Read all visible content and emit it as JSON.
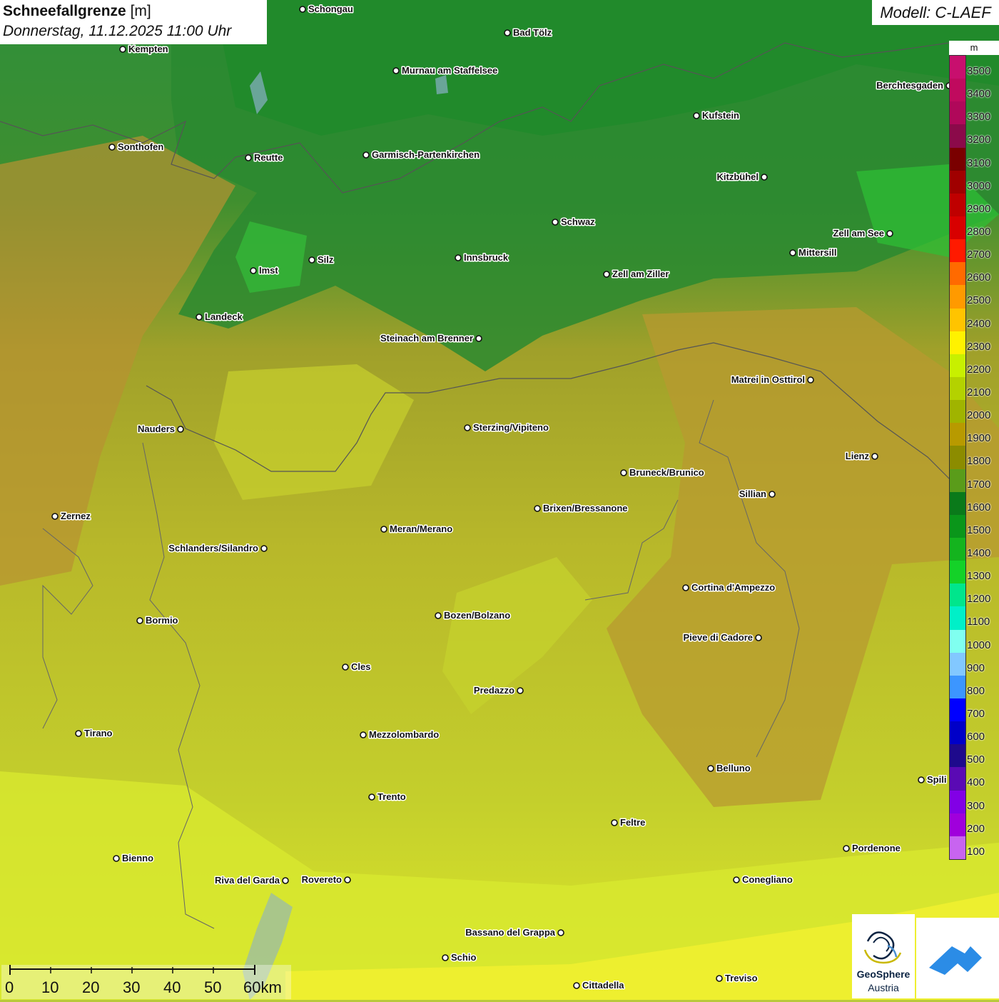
{
  "title": {
    "parameter": "Schneefallgrenze",
    "unit": "[m]",
    "datetime": "Donnerstag, 11.12.2025 11:00 Uhr"
  },
  "model": "Modell: C-LAEF",
  "legend": {
    "unit": "m",
    "levels": [
      "3500",
      "3400",
      "3300",
      "3200",
      "3100",
      "3000",
      "2900",
      "2800",
      "2700",
      "2600",
      "2500",
      "2400",
      "2300",
      "2200",
      "2100",
      "2000",
      "1900",
      "1800",
      "1700",
      "1600",
      "1500",
      "1400",
      "1300",
      "1200",
      "1100",
      "1000",
      "900",
      "800",
      "700",
      "600",
      "500",
      "400",
      "300",
      "200",
      "100"
    ],
    "colors": [
      "#c80f6e",
      "#c00a5e",
      "#b0085a",
      "#8b0a4a",
      "#7a0000",
      "#a00000",
      "#bf0000",
      "#d80000",
      "#ff1a00",
      "#ff6a00",
      "#ff9a00",
      "#ffc400",
      "#fff200",
      "#c8f000",
      "#b4d200",
      "#a0b400",
      "#b89a00",
      "#8c8c00",
      "#5a9c1a",
      "#0a7a1a",
      "#0a961a",
      "#14b41e",
      "#14d228",
      "#00e68c",
      "#00f0c8",
      "#80fff0",
      "#82c8ff",
      "#3c96ff",
      "#0000ff",
      "#0000c8",
      "#1e0a8c",
      "#5a0ab4",
      "#8200e6",
      "#a000dc",
      "#c864f0"
    ]
  },
  "cities": [
    {
      "name": "Schongau"
    },
    {
      "name": "Bad Tölz"
    },
    {
      "name": "Kempten"
    },
    {
      "name": "Murnau am Staffelsee"
    },
    {
      "name": "Berchtesgaden"
    },
    {
      "name": "Kufstein"
    },
    {
      "name": "Sonthofen"
    },
    {
      "name": "Reutte"
    },
    {
      "name": "Garmisch-Partenkirchen"
    },
    {
      "name": "Kitzbühel"
    },
    {
      "name": "Schwaz"
    },
    {
      "name": "Zell am See"
    },
    {
      "name": "Innsbruck"
    },
    {
      "name": "Silz"
    },
    {
      "name": "Mittersill"
    },
    {
      "name": "Imst"
    },
    {
      "name": "Zell am Ziller"
    },
    {
      "name": "Landeck"
    },
    {
      "name": "Steinach am Brenner"
    },
    {
      "name": "Matrei in Osttirol"
    },
    {
      "name": "Nauders"
    },
    {
      "name": "Sterzing/Vipiteno"
    },
    {
      "name": "Lienz"
    },
    {
      "name": "Bruneck/Brunico"
    },
    {
      "name": "Sillian"
    },
    {
      "name": "Zernez"
    },
    {
      "name": "Brixen/Bressanone"
    },
    {
      "name": "Meran/Merano"
    },
    {
      "name": "Schlanders/Silandro"
    },
    {
      "name": "Cortina d'Ampezzo"
    },
    {
      "name": "Bozen/Bolzano"
    },
    {
      "name": "Bormio"
    },
    {
      "name": "Pieve di Cadore"
    },
    {
      "name": "Cles"
    },
    {
      "name": "Predazzo"
    },
    {
      "name": "Tirano"
    },
    {
      "name": "Mezzolombardo"
    },
    {
      "name": "Belluno"
    },
    {
      "name": "Spili"
    },
    {
      "name": "Trento"
    },
    {
      "name": "Feltre"
    },
    {
      "name": "Bienno"
    },
    {
      "name": "Pordenone"
    },
    {
      "name": "Riva del Garda"
    },
    {
      "name": "Rovereto"
    },
    {
      "name": "Conegliano"
    },
    {
      "name": "Bassano del Grappa"
    },
    {
      "name": "Schio"
    },
    {
      "name": "Treviso"
    },
    {
      "name": "Cittadella"
    }
  ],
  "scale": {
    "ticks": [
      "0",
      "10",
      "20",
      "30",
      "40",
      "50",
      "60km"
    ]
  },
  "logo": {
    "line1": "GeoSphere",
    "line2": "Austria"
  }
}
